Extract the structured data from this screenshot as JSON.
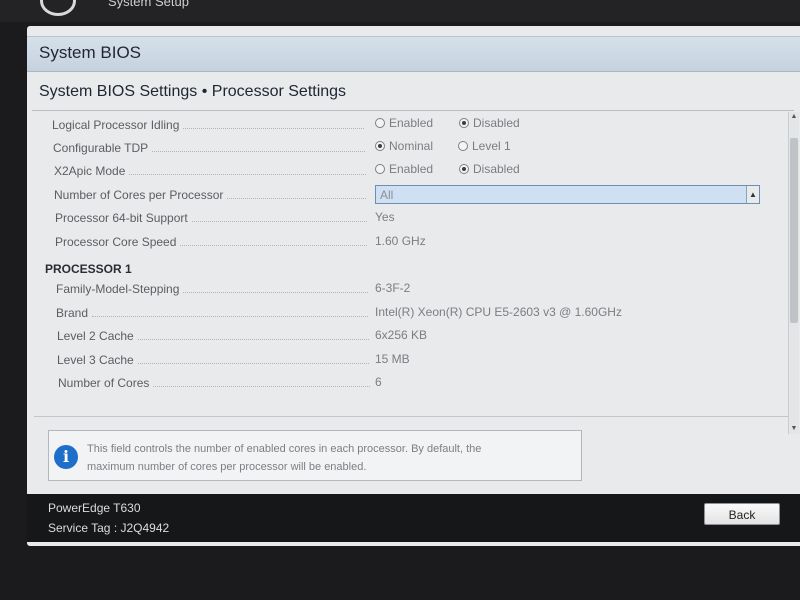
{
  "window": {
    "title": "System Setup"
  },
  "header": {
    "title": "System BIOS",
    "subtitle": "System BIOS Settings • Processor Settings"
  },
  "settings": [
    {
      "label": "Logical Processor Idling",
      "options": [
        "Enabled",
        "Disabled"
      ],
      "selected": "Disabled"
    },
    {
      "label": "Configurable TDP",
      "options": [
        "Nominal",
        "Level 1"
      ],
      "selected": "Nominal"
    },
    {
      "label": "X2Apic Mode",
      "options": [
        "Enabled",
        "Disabled"
      ],
      "selected": "Disabled"
    },
    {
      "label": "Number of Cores per Processor",
      "value": "All"
    },
    {
      "label": "Processor 64-bit Support",
      "value": "Yes"
    },
    {
      "label": "Processor Core Speed",
      "value": "1.60 GHz"
    }
  ],
  "processor1": {
    "heading": "PROCESSOR 1",
    "rows": [
      {
        "label": "Family-Model-Stepping",
        "value": "6-3F-2"
      },
      {
        "label": "Brand",
        "value": "Intel(R) Xeon(R) CPU E5-2603 v3 @ 1.60GHz"
      },
      {
        "label": "Level 2 Cache",
        "value": "6x256 KB"
      },
      {
        "label": "Level 3 Cache",
        "value": "15 MB"
      },
      {
        "label": "Number of Cores",
        "value": "6"
      }
    ]
  },
  "help": {
    "icon": "info-icon",
    "line1": "This field controls the number of enabled cores in each processor. By default, the",
    "line2": "maximum number of cores per processor will be enabled."
  },
  "footer": {
    "model": "PowerEdge T630",
    "service_tag": "Service Tag : J2Q4942",
    "back_label": "Back"
  }
}
